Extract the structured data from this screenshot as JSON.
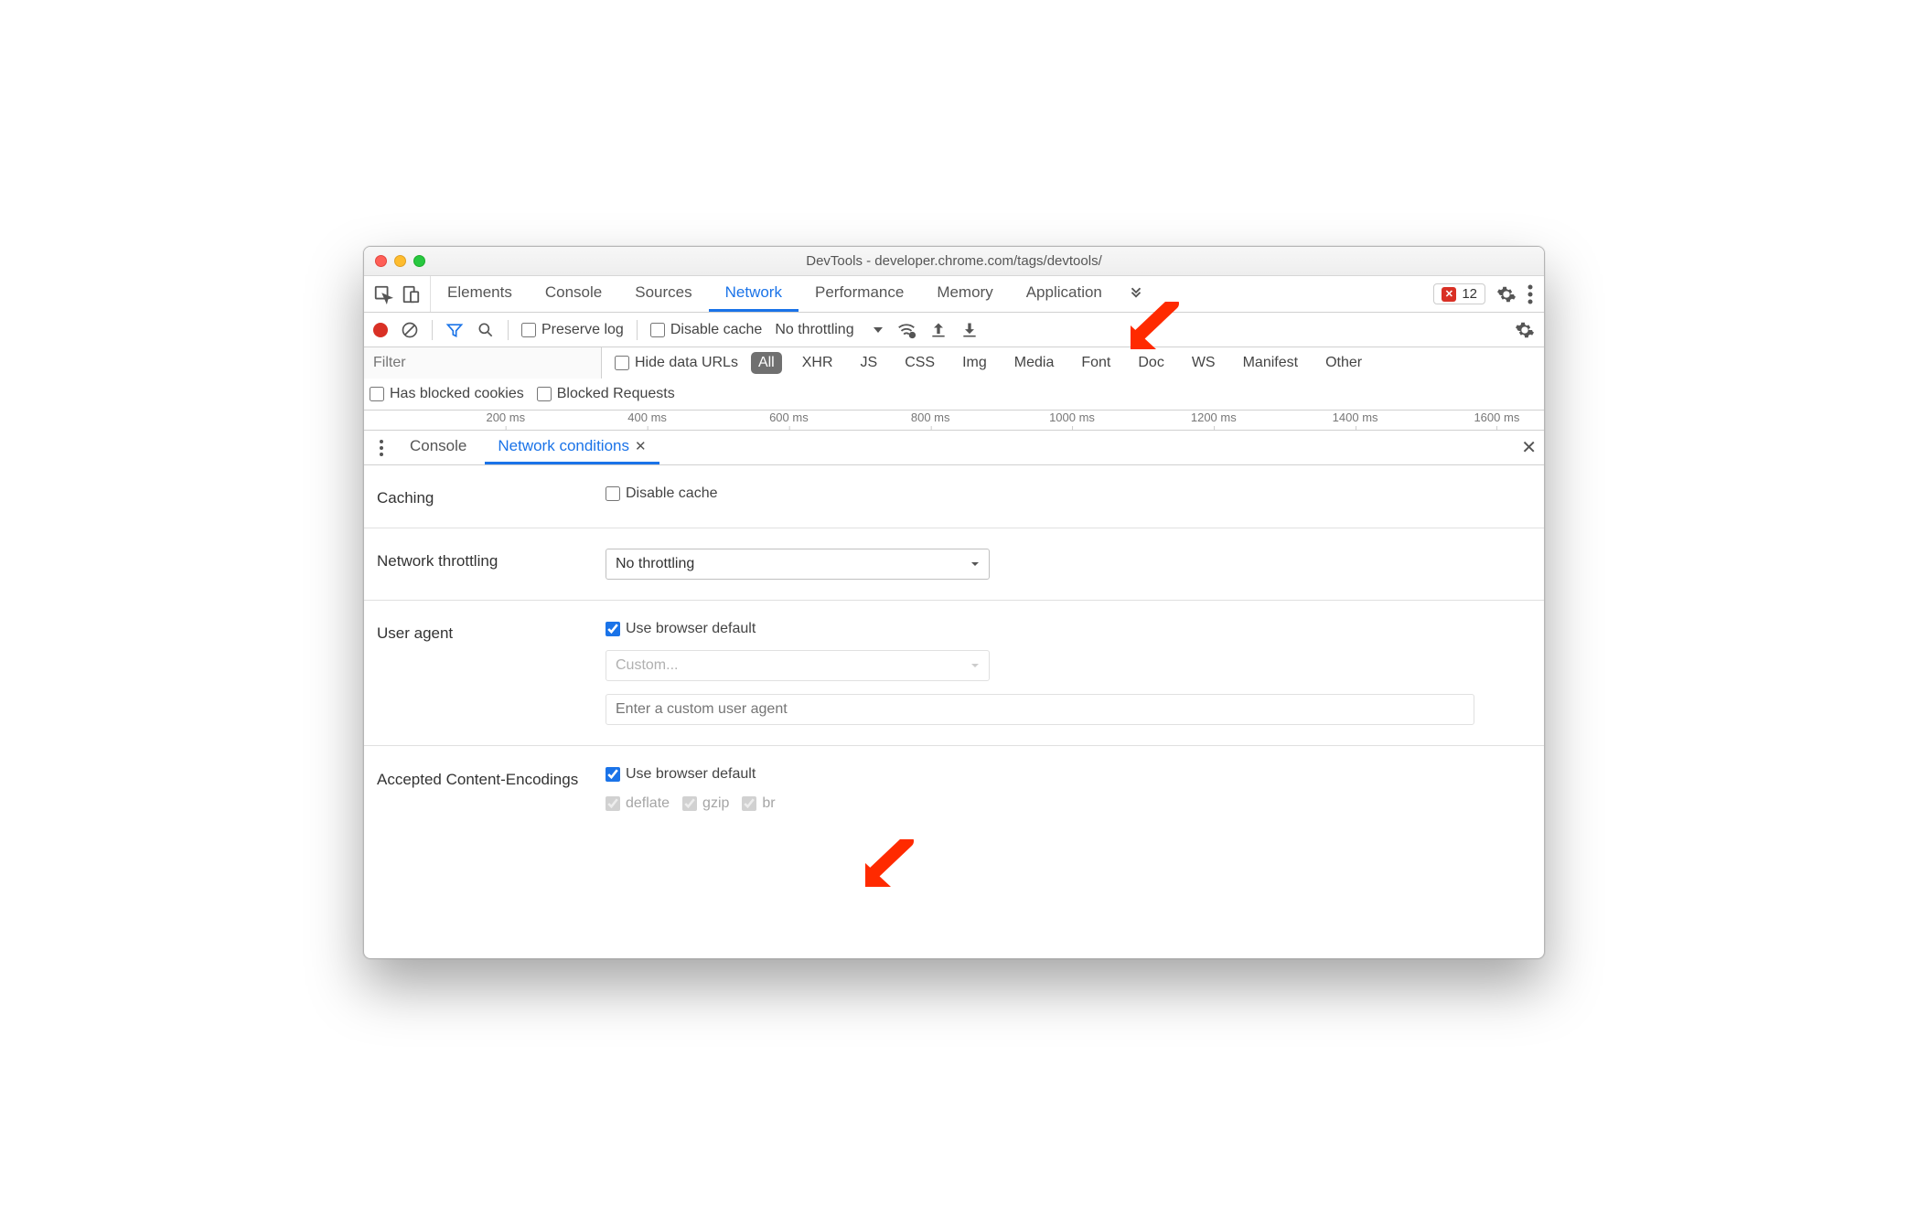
{
  "titlebar": {
    "title": "DevTools - developer.chrome.com/tags/devtools/"
  },
  "main_tabs": [
    "Elements",
    "Console",
    "Sources",
    "Network",
    "Performance",
    "Memory",
    "Application"
  ],
  "main_tab_active_index": 3,
  "error_badge": {
    "count": "12"
  },
  "toolbar": {
    "preserve_log": "Preserve log",
    "disable_cache": "Disable cache",
    "throttling": "No throttling"
  },
  "filter": {
    "placeholder": "Filter",
    "hide_data_urls": "Hide data URLs",
    "types": [
      "All",
      "XHR",
      "JS",
      "CSS",
      "Img",
      "Media",
      "Font",
      "Doc",
      "WS",
      "Manifest",
      "Other"
    ],
    "has_blocked_cookies": "Has blocked cookies",
    "blocked_requests": "Blocked Requests"
  },
  "timeline_ticks": [
    "200 ms",
    "400 ms",
    "600 ms",
    "800 ms",
    "1000 ms",
    "1200 ms",
    "1400 ms",
    "1600 ms"
  ],
  "drawer": {
    "tabs": [
      "Console",
      "Network conditions"
    ],
    "active_index": 1
  },
  "sections": {
    "caching": {
      "label": "Caching",
      "checkbox": "Disable cache"
    },
    "throttling": {
      "label": "Network throttling",
      "select": "No throttling"
    },
    "user_agent": {
      "label": "User agent",
      "use_default": "Use browser default",
      "custom_select": "Custom...",
      "custom_input_placeholder": "Enter a custom user agent"
    },
    "encodings": {
      "label": "Accepted Content-Encodings",
      "use_default": "Use browser default",
      "options": [
        "deflate",
        "gzip",
        "br"
      ]
    }
  }
}
